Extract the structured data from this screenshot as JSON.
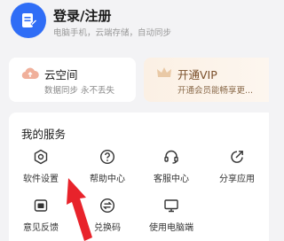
{
  "header": {
    "title": "登录/注册",
    "subtitle": "电脑手机，云端存储，自动同步"
  },
  "cloud_card": {
    "title": "云空间",
    "subtitle": "数据同步 永不丢失"
  },
  "vip_card": {
    "title": "开通VIP",
    "subtitle": "开通会员能畅享更..."
  },
  "services": {
    "title": "我的服务",
    "items": [
      {
        "label": "软件设置",
        "icon": "settings-icon"
      },
      {
        "label": "帮助中心",
        "icon": "help-icon"
      },
      {
        "label": "客服中心",
        "icon": "headset-icon"
      },
      {
        "label": "分享应用",
        "icon": "share-icon"
      },
      {
        "label": "意见反馈",
        "icon": "feedback-icon"
      },
      {
        "label": "兑换码",
        "icon": "exchange-icon"
      },
      {
        "label": "使用电脑端",
        "icon": "monitor-icon"
      }
    ]
  },
  "colors": {
    "brand_blue": "#2f6df6",
    "vip_brown": "#7a4f2a",
    "annotation_red": "#e8232b"
  }
}
